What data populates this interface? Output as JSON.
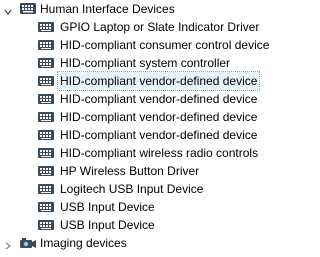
{
  "tree": {
    "category_hid": {
      "label": "Human Interface Devices",
      "expanded": true,
      "icon": "hid-keyboard-icon",
      "devices": [
        {
          "label": "GPIO Laptop or Slate Indicator Driver",
          "icon": "hid-device-icon"
        },
        {
          "label": "HID-compliant consumer control device",
          "icon": "hid-device-icon"
        },
        {
          "label": "HID-compliant system controller",
          "icon": "hid-device-icon"
        },
        {
          "label": "HID-compliant vendor-defined device",
          "icon": "hid-device-icon",
          "selected": true
        },
        {
          "label": "HID-compliant vendor-defined device",
          "icon": "hid-device-icon"
        },
        {
          "label": "HID-compliant vendor-defined device",
          "icon": "hid-device-icon"
        },
        {
          "label": "HID-compliant vendor-defined device",
          "icon": "hid-device-icon"
        },
        {
          "label": "HID-compliant wireless radio controls",
          "icon": "hid-device-icon"
        },
        {
          "label": "HP Wireless Button Driver",
          "icon": "hid-device-icon"
        },
        {
          "label": "Logitech USB Input Device",
          "icon": "hid-device-icon"
        },
        {
          "label": "USB Input Device",
          "icon": "hid-device-icon"
        },
        {
          "label": "USB Input Device",
          "icon": "hid-device-icon"
        }
      ]
    },
    "category_imaging": {
      "label": "Imaging devices",
      "expanded": false,
      "icon": "camera-icon"
    }
  },
  "colors": {
    "selection_bg": "#e5f3fb",
    "selection_border": "#7aa7c7",
    "icon_body": "#3b4b5a",
    "icon_keys": "#ffffff"
  }
}
